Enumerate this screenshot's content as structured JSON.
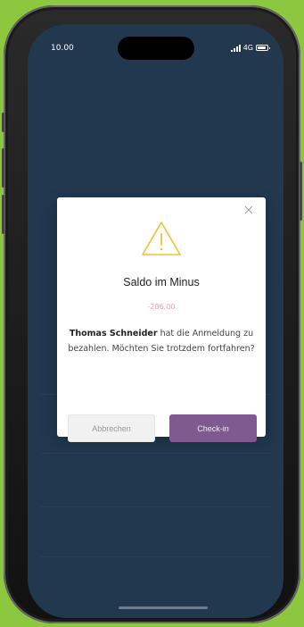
{
  "status_bar": {
    "time": "10.00",
    "network": "4G"
  },
  "dialog": {
    "title": "Saldo im Minus",
    "amount": "-286,00",
    "message_name": "Thomas Schneider",
    "message_rest": " hat die Anmeldung zu bezahlen. Möchten Sie trotzdem fortfahren?",
    "cancel_label": "Abbrechen",
    "confirm_label": "Check-in"
  },
  "colors": {
    "background": "#8dc63f",
    "screen": "#22384f",
    "accent": "#7e5a91",
    "warning": "#f2c12e",
    "amount": "#f2a4ad"
  },
  "icons": {
    "warning": "warning-triangle-icon",
    "close": "close-icon",
    "signal": "signal-icon",
    "battery": "battery-icon"
  }
}
